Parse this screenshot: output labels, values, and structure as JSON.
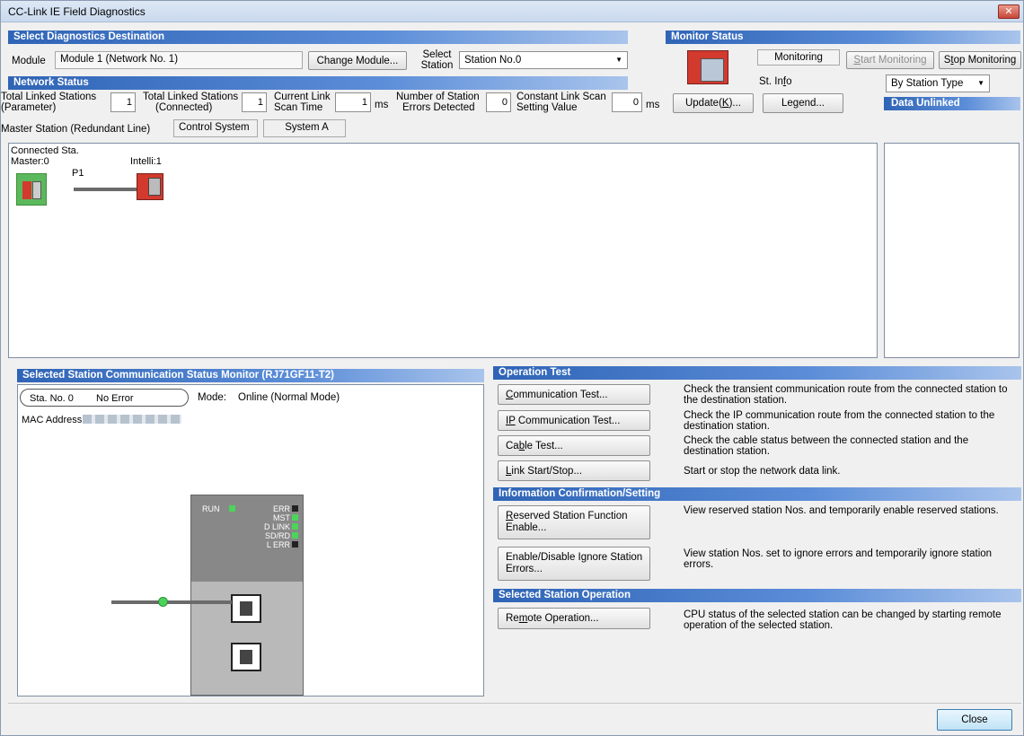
{
  "window": {
    "title": "CC-Link IE Field Diagnostics",
    "close_glyph": "✕"
  },
  "diag_dest": {
    "header": "Select Diagnostics Destination",
    "module_label": "Module",
    "module_value": "Module 1 (Network No. 1)",
    "change_module_button": "Change Module...",
    "select_station_label_1": "Select",
    "select_station_label_2": "Station",
    "station_value": "Station No.0"
  },
  "monitor": {
    "header": "Monitor Status",
    "status_text": "Monitoring",
    "start_button_u": "S",
    "start_button_rest": "tart Monitoring",
    "stop_button_pre": "S",
    "stop_button_u": "t",
    "stop_button_rest": "op Monitoring",
    "st_info_pre": "St. In",
    "st_info_u": "f",
    "st_info_rest": "o",
    "st_info_combo": "By Station Type",
    "update_pre": "Update(",
    "update_u": "K",
    "update_rest": ")...",
    "legend_pre": "Le",
    "legend_u": "g",
    "legend_rest": "end...",
    "data_unlinked_header": "Data Unlinked"
  },
  "network_status": {
    "header": "Network Status",
    "total_param_l1": "Total Linked Stations",
    "total_param_l2": "(Parameter)",
    "total_param_val": "1",
    "total_conn_l1": "Total Linked Stations",
    "total_conn_l2": "(Connected)",
    "total_conn_val": "1",
    "link_scan_l1": "Current Link",
    "link_scan_l2": "Scan Time",
    "link_scan_val": "1",
    "link_scan_unit": "ms",
    "station_err_l1": "Number of Station",
    "station_err_l2": "Errors Detected",
    "station_err_val": "0",
    "const_scan_l1": "Constant Link Scan",
    "const_scan_l2": "Setting Value",
    "const_scan_val": "0",
    "const_scan_unit": "ms",
    "master_label": "Master Station (Redundant Line)",
    "control_system": "Control System",
    "system_value": "System A"
  },
  "topology": {
    "connected_label": "Connected Sta.",
    "master_label": "Master:0",
    "port_label": "P1",
    "intelli_label": "Intelli:1"
  },
  "station_monitor": {
    "header": "Selected Station Communication Status Monitor (RJ71GF11-T2)",
    "sta_no": "Sta. No. 0",
    "status": "No Error",
    "mode_label": "Mode:",
    "mode_value": "Online (Normal Mode)",
    "mac_label": "MAC Address:",
    "leds": {
      "run": "RUN",
      "err": "ERR",
      "mst": "MST",
      "dlink": "D LINK",
      "sdrd": "SD/RD",
      "lerr": "L ERR"
    }
  },
  "operation_test": {
    "header": "Operation Test",
    "comm_test_u": "C",
    "comm_test_rest": "ommunication Test...",
    "comm_test_desc": "Check the transient communication route from the connected station to the destination station.",
    "ip_test_u": "I",
    "ip_test_mid": "P",
    "ip_test_rest": " Communication Test...",
    "ip_test_desc": "Check the IP communication route from the connected station to the destination station.",
    "cable_pre": "Ca",
    "cable_u": "b",
    "cable_rest": "le Test...",
    "cable_desc": "Check the cable status between the connected station and the destination station.",
    "link_u": "L",
    "link_rest": "ink Start/Stop...",
    "link_desc": "Start or stop the network data link."
  },
  "info_confirm": {
    "header": "Information Confirmation/Setting",
    "reserved_u": "R",
    "reserved_l1_rest": "eserved Station Function",
    "reserved_l2": "Enable...",
    "reserved_desc": "View reserved station Nos. and temporarily enable reserved stations.",
    "ignore_l1_pre": "Enable/Disable I",
    "ignore_l1_u": "g",
    "ignore_l1_rest": "nore Station",
    "ignore_l2": "Errors...",
    "ignore_desc": "View station Nos. set to ignore errors and temporarily ignore station errors."
  },
  "station_op": {
    "header": "Selected Station Operation",
    "remote_pre": "Re",
    "remote_u": "m",
    "remote_rest": "ote Operation...",
    "remote_desc": "CPU status of the selected station can be changed by starting remote operation of the selected station."
  },
  "footer": {
    "close_button": "Close"
  },
  "colors": {
    "section_header": "#2f64b6",
    "led_green": "#4cd45a",
    "master_icon_bg": "#5cb85c"
  }
}
